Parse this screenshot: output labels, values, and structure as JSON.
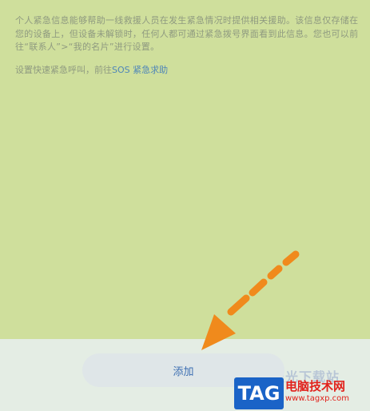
{
  "emergency_info": {
    "description": "个人紧急信息能够帮助一线救援人员在发生紧急情况时提供相关援助。该信息仅存储在您的设备上，但设备未解锁时，任何人都可通过紧急拨号界面看到此信息。您也可以前往“联系人”>“我的名片”进行设置。",
    "sos_prefix": "设置快速紧急呼叫，前往",
    "sos_link": "SOS 紧急求助"
  },
  "footer": {
    "add_label": "添加"
  },
  "overlay": {
    "arrow_color": "#f08a1c",
    "faint_text": "极光下载站",
    "logo_text": "TAG",
    "site_name": "电脑技术网",
    "site_url": "www.tagxp.com"
  }
}
